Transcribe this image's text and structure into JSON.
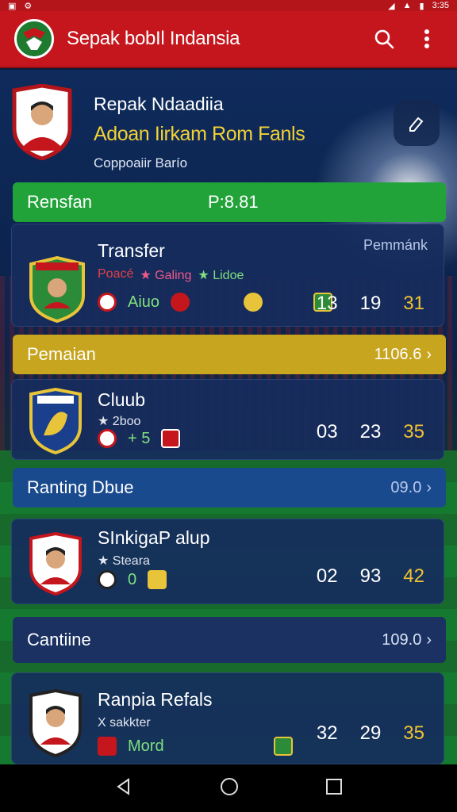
{
  "status_bar": {
    "time": "3:35"
  },
  "app_bar": {
    "title": "Sepak bobIl Indansia"
  },
  "header": {
    "name": "Repak Ndaadiia",
    "subtitle": "Adoan Iirkam Rom Fanls",
    "caption": "Coppoaiir Barío"
  },
  "sections": [
    {
      "label": "Rensfan",
      "value": "P:8.81",
      "color": "#22a33a"
    },
    {
      "label": "Pemaian",
      "value": "1106.6",
      "color": "#c7a51e"
    },
    {
      "label": "Ranting Dbue",
      "value": "09.0",
      "color": "#1a4a8e"
    },
    {
      "label": "Cantiine",
      "value": "109.0",
      "color": "#1a3162"
    }
  ],
  "cards": [
    {
      "title": "Transfer",
      "corner": "Pemmánk",
      "meta": [
        "Poacé",
        "★ Galing",
        "★ Lidoe"
      ],
      "icon_text": "Aiuo",
      "stats": [
        "13",
        "19",
        "31"
      ]
    },
    {
      "title": "Cluub",
      "meta": [
        "★ 2boo"
      ],
      "icon_text": "+ 5",
      "stats": [
        "03",
        "23",
        "35"
      ]
    },
    {
      "title": "SInkigaP alup",
      "meta": [
        "★ Steara"
      ],
      "icon_text": "0",
      "stats": [
        "02",
        "93",
        "42"
      ]
    },
    {
      "title": "Ranpia Refals",
      "meta": [
        "X sakkter"
      ],
      "icon_text": "Mord",
      "stats": [
        "32",
        "29",
        "35"
      ]
    }
  ],
  "colors": {
    "primary_red": "#c5161d",
    "highlight_yellow": "#f1c232",
    "card_navy": "#162c5c",
    "green": "#22a33a"
  }
}
